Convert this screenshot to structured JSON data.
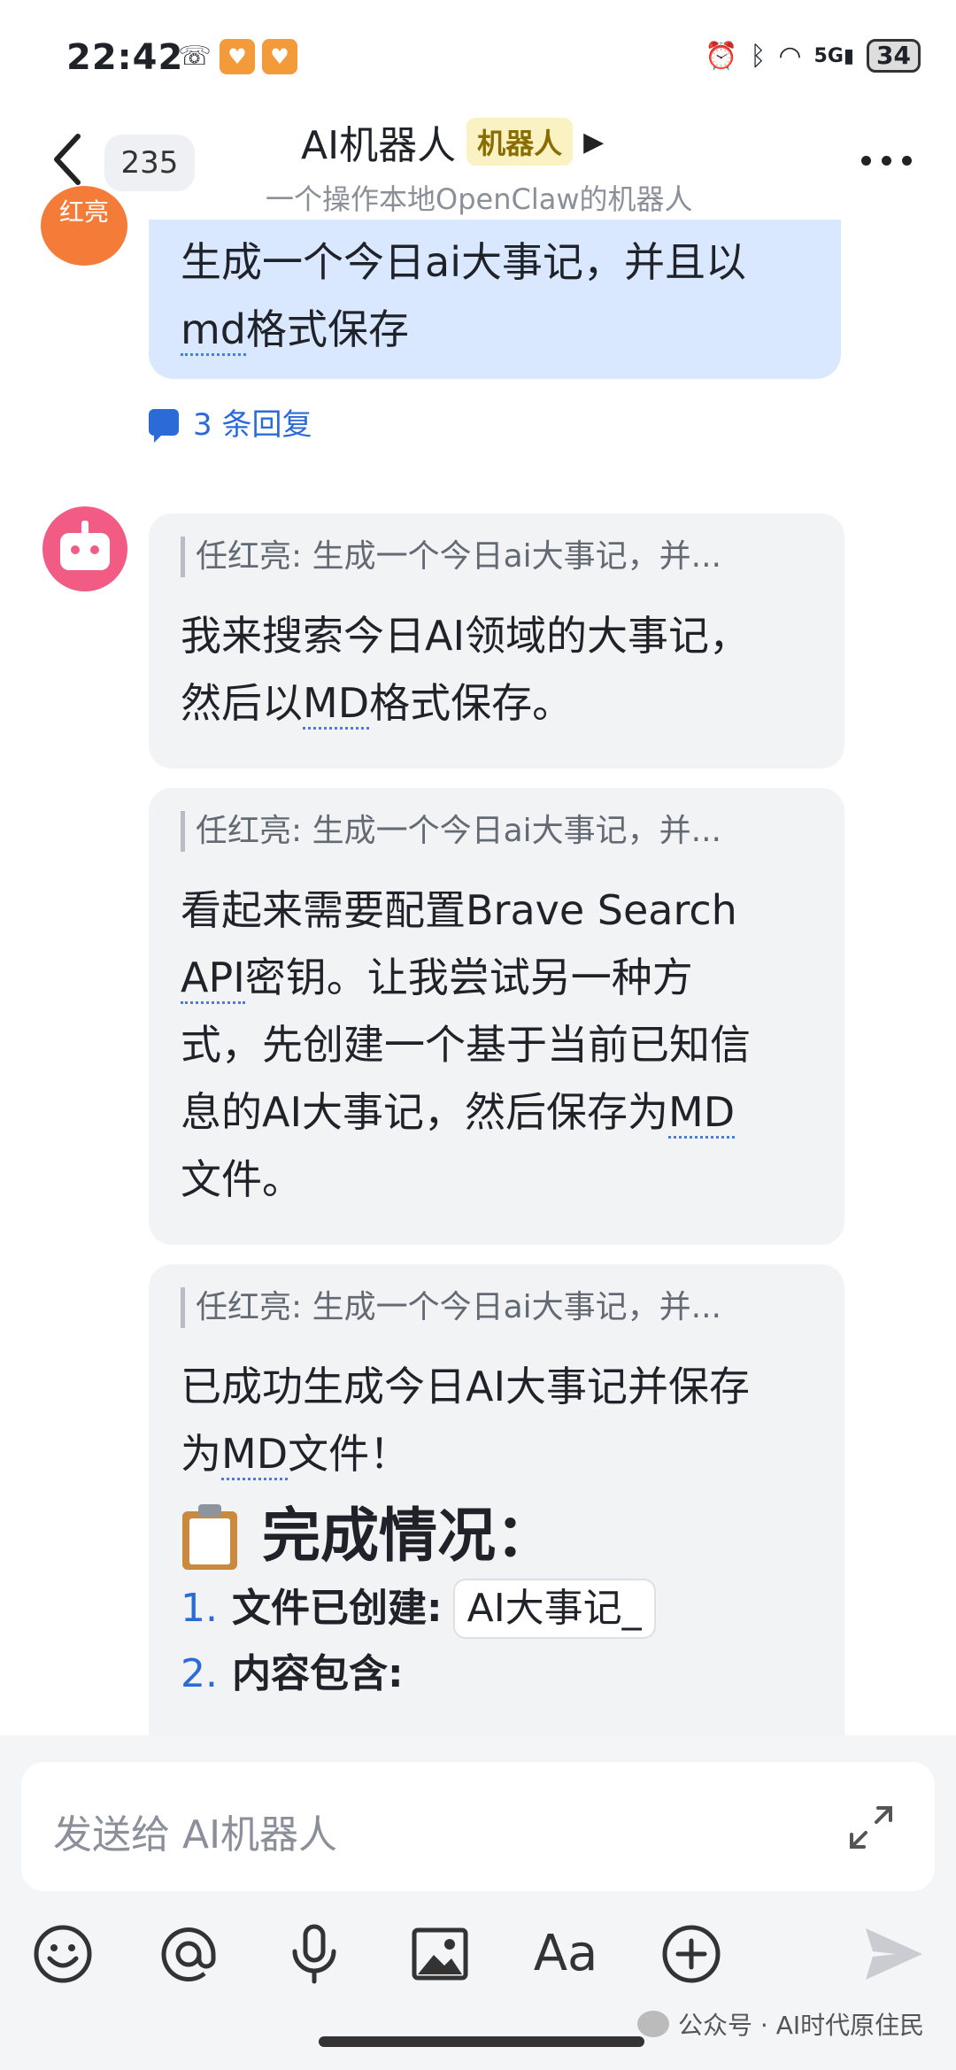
{
  "status": {
    "time": "22:42",
    "battery": "34",
    "signal": "5G"
  },
  "header": {
    "unread_count": "235",
    "title": "AI机器人",
    "tag": "机器人",
    "subtitle": "一个操作本地OpenClaw的机器人"
  },
  "user_message": {
    "avatar_text": "红亮",
    "text_line1": "生成一个今日ai大事记，并且以",
    "text_md": "md",
    "text_line2_rest": "格式保存",
    "replies": "3 条回复"
  },
  "bot_messages": [
    {
      "quote": "任红亮: 生成一个今日ai大事记，并...",
      "line1": "我来搜索今日AI领域的大事记，",
      "line2_pre": "然后以",
      "line2_md": "MD",
      "line2_post": "格式保存。"
    },
    {
      "quote": "任红亮: 生成一个今日ai大事记，并...",
      "line1": "看起来需要配置Brave Search",
      "line2_api": "API",
      "line2_post": "密钥。让我尝试另一种方",
      "line3": "式，先创建一个基于当前已知信",
      "line4_pre": "息的AI大事记，然后保存为",
      "line4_md": "MD",
      "line5": "文件。"
    },
    {
      "quote": "任红亮: 生成一个今日ai大事记，并...",
      "line1": "已成功生成今日AI大事记并保存",
      "line2_pre": "为",
      "line2_md": "MD",
      "line2_post": "文件！",
      "heading": "完成情况：",
      "items": [
        {
          "num": "1.",
          "label": "文件已创建:",
          "code": "AI大事记_"
        },
        {
          "num": "2.",
          "label": "内容包含:"
        }
      ]
    }
  ],
  "input": {
    "placeholder": "发送给 AI机器人"
  },
  "watermark": "公众号 · AI时代原住民",
  "icons": [
    "emoji-icon",
    "mention-icon",
    "mic-icon",
    "image-icon",
    "text-format-icon",
    "plus-icon",
    "send-icon"
  ]
}
